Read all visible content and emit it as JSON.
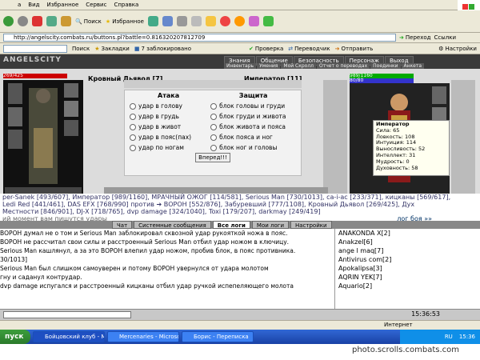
{
  "menu": [
    "а",
    "Вид",
    "Избранное",
    "Сервис",
    "Справка"
  ],
  "toolbar": {
    "search": "Поиск",
    "favorites": "Избранное",
    "proverka": "Проверка",
    "perevodchik": "Переводчик",
    "otpravit": "Отправить",
    "nastroiki": "Настройки"
  },
  "address": {
    "url": "http://angelscity.combats.ru/buttons.pl?battle=0.816320207812709",
    "go": "Переход",
    "links": "Ссылки"
  },
  "links": {
    "poisk": "Поиск",
    "zakladki": "Закладки",
    "blocked": "7 заблокировано"
  },
  "game": {
    "logo": "ANGELSCITY",
    "nav": [
      "Знания",
      "Общение",
      "Безопасность",
      "Персонаж",
      "Выход"
    ],
    "subnav": [
      "Инвентарь",
      "Умения",
      "Мой Скролл",
      "Отчет о переводах",
      "Поединки",
      "Анкета"
    ],
    "left_hp": "269/425",
    "right_hp": "989/1160",
    "right_mp": "80/80",
    "left_name": "Кровный Дьявол [7]",
    "right_name": "Император [11]",
    "attack_title": "Атака",
    "defense_title": "Защита",
    "attacks": [
      "удар в голову",
      "удар в грудь",
      "удар в живот",
      "удар в пояс(пах)",
      "удар по ногам"
    ],
    "defenses": [
      "блок головы и груди",
      "блок груди и живота",
      "блок живота и пояса",
      "блок пояса и ног",
      "блок ног и головы"
    ],
    "forward": "Вперед!!!",
    "stats": [
      "Император",
      "Сила: 65",
      "Ловкость: 108",
      "Интуиция: 114",
      "Выносливость: 52",
      "Интеллект: 31",
      "Мудрость: 0",
      "Духовность: 58"
    ]
  },
  "log": {
    "line1": "per-Sanek [493/607], Император [989/1160], МРАЧНЫЙ ОЖОГ [114/581], Serious Man [730/1013], са-i-ас [233/371], кицканы [569/617],",
    "line2": "Ledi Red [441/461], DAS EFX [768/990]  против  ➔ ВОРОН [552/876], Забуревший [777/1108], Кровный Дьявол [269/425], Дух",
    "line3": "Местности [846/901], DJ-X [718/765], dvp damage [324/1040], Toxi [179/207], darkmay [249/419]",
    "line4": "ий момент вам пишутся удары",
    "more": "лог боя »»"
  },
  "tabs": [
    "Чат",
    "Системные сообщения",
    "Все логи",
    "Мои логи",
    "Настройки"
  ],
  "chat": [
    "ВОРОН думал не о том и Serious Man заблокировал сквозной удар рукояткой ножа в пояс.",
    "ВОРОН не рассчитал свои силы и расстроенный Serious Man отбил удар ножом в ключицу.",
    "Serious Man кашлянул, а за это ВОРОН влепил удар ножом, пробив блок, в пояс противника.",
    "30/1013]",
    "Serious Man был слишком самоуверен и потому ВОРОН увернулся от удара молотом",
    "гну и саданул контрудар.",
    "dvp damage испугался и расстроенный кицканы отбил удар ручкой испепеляющего молота"
  ],
  "who": [
    "ANAKONDA X[2]",
    "Anakzel[6]",
    "ange l maq[7]",
    "Antivirus com[2]",
    "Apokalipsa[3]",
    "AQRIN YEK[7]",
    "Aquario[2]"
  ],
  "status": {
    "zone": "Интернет",
    "time": "15:36",
    "clock": "15:36:53"
  },
  "taskbar": {
    "start": "пуск",
    "tasks": [
      "Бойцовский клуб - М...",
      "Mercenaries - Microso...",
      "Борис - Переписка"
    ],
    "lang": "RU",
    "time": "15:36"
  },
  "watermark": "photo.scrolls.combats.com"
}
